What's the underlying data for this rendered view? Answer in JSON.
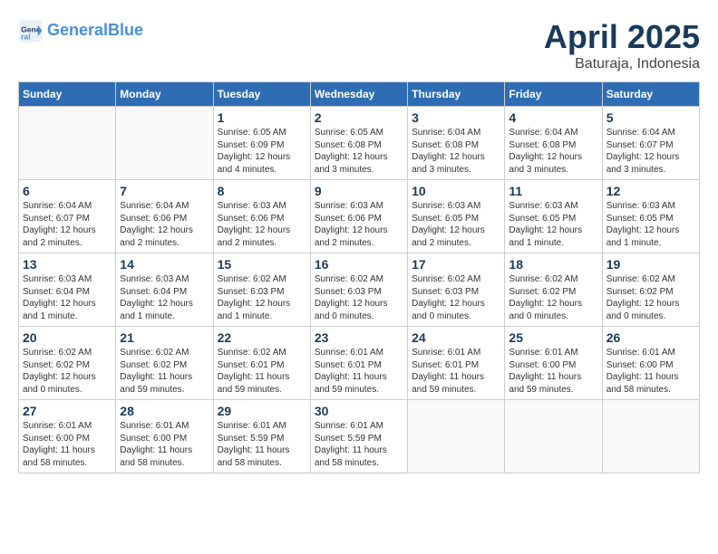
{
  "header": {
    "logo_line1": "General",
    "logo_line2": "Blue",
    "month": "April 2025",
    "location": "Baturaja, Indonesia"
  },
  "weekdays": [
    "Sunday",
    "Monday",
    "Tuesday",
    "Wednesday",
    "Thursday",
    "Friday",
    "Saturday"
  ],
  "weeks": [
    [
      {
        "day": "",
        "info": ""
      },
      {
        "day": "",
        "info": ""
      },
      {
        "day": "1",
        "info": "Sunrise: 6:05 AM\nSunset: 6:09 PM\nDaylight: 12 hours\nand 4 minutes."
      },
      {
        "day": "2",
        "info": "Sunrise: 6:05 AM\nSunset: 6:08 PM\nDaylight: 12 hours\nand 3 minutes."
      },
      {
        "day": "3",
        "info": "Sunrise: 6:04 AM\nSunset: 6:08 PM\nDaylight: 12 hours\nand 3 minutes."
      },
      {
        "day": "4",
        "info": "Sunrise: 6:04 AM\nSunset: 6:08 PM\nDaylight: 12 hours\nand 3 minutes."
      },
      {
        "day": "5",
        "info": "Sunrise: 6:04 AM\nSunset: 6:07 PM\nDaylight: 12 hours\nand 3 minutes."
      }
    ],
    [
      {
        "day": "6",
        "info": "Sunrise: 6:04 AM\nSunset: 6:07 PM\nDaylight: 12 hours\nand 2 minutes."
      },
      {
        "day": "7",
        "info": "Sunrise: 6:04 AM\nSunset: 6:06 PM\nDaylight: 12 hours\nand 2 minutes."
      },
      {
        "day": "8",
        "info": "Sunrise: 6:03 AM\nSunset: 6:06 PM\nDaylight: 12 hours\nand 2 minutes."
      },
      {
        "day": "9",
        "info": "Sunrise: 6:03 AM\nSunset: 6:06 PM\nDaylight: 12 hours\nand 2 minutes."
      },
      {
        "day": "10",
        "info": "Sunrise: 6:03 AM\nSunset: 6:05 PM\nDaylight: 12 hours\nand 2 minutes."
      },
      {
        "day": "11",
        "info": "Sunrise: 6:03 AM\nSunset: 6:05 PM\nDaylight: 12 hours\nand 1 minute."
      },
      {
        "day": "12",
        "info": "Sunrise: 6:03 AM\nSunset: 6:05 PM\nDaylight: 12 hours\nand 1 minute."
      }
    ],
    [
      {
        "day": "13",
        "info": "Sunrise: 6:03 AM\nSunset: 6:04 PM\nDaylight: 12 hours\nand 1 minute."
      },
      {
        "day": "14",
        "info": "Sunrise: 6:03 AM\nSunset: 6:04 PM\nDaylight: 12 hours\nand 1 minute."
      },
      {
        "day": "15",
        "info": "Sunrise: 6:02 AM\nSunset: 6:03 PM\nDaylight: 12 hours\nand 1 minute."
      },
      {
        "day": "16",
        "info": "Sunrise: 6:02 AM\nSunset: 6:03 PM\nDaylight: 12 hours\nand 0 minutes."
      },
      {
        "day": "17",
        "info": "Sunrise: 6:02 AM\nSunset: 6:03 PM\nDaylight: 12 hours\nand 0 minutes."
      },
      {
        "day": "18",
        "info": "Sunrise: 6:02 AM\nSunset: 6:02 PM\nDaylight: 12 hours\nand 0 minutes."
      },
      {
        "day": "19",
        "info": "Sunrise: 6:02 AM\nSunset: 6:02 PM\nDaylight: 12 hours\nand 0 minutes."
      }
    ],
    [
      {
        "day": "20",
        "info": "Sunrise: 6:02 AM\nSunset: 6:02 PM\nDaylight: 12 hours\nand 0 minutes."
      },
      {
        "day": "21",
        "info": "Sunrise: 6:02 AM\nSunset: 6:02 PM\nDaylight: 11 hours\nand 59 minutes."
      },
      {
        "day": "22",
        "info": "Sunrise: 6:02 AM\nSunset: 6:01 PM\nDaylight: 11 hours\nand 59 minutes."
      },
      {
        "day": "23",
        "info": "Sunrise: 6:01 AM\nSunset: 6:01 PM\nDaylight: 11 hours\nand 59 minutes."
      },
      {
        "day": "24",
        "info": "Sunrise: 6:01 AM\nSunset: 6:01 PM\nDaylight: 11 hours\nand 59 minutes."
      },
      {
        "day": "25",
        "info": "Sunrise: 6:01 AM\nSunset: 6:00 PM\nDaylight: 11 hours\nand 59 minutes."
      },
      {
        "day": "26",
        "info": "Sunrise: 6:01 AM\nSunset: 6:00 PM\nDaylight: 11 hours\nand 58 minutes."
      }
    ],
    [
      {
        "day": "27",
        "info": "Sunrise: 6:01 AM\nSunset: 6:00 PM\nDaylight: 11 hours\nand 58 minutes."
      },
      {
        "day": "28",
        "info": "Sunrise: 6:01 AM\nSunset: 6:00 PM\nDaylight: 11 hours\nand 58 minutes."
      },
      {
        "day": "29",
        "info": "Sunrise: 6:01 AM\nSunset: 5:59 PM\nDaylight: 11 hours\nand 58 minutes."
      },
      {
        "day": "30",
        "info": "Sunrise: 6:01 AM\nSunset: 5:59 PM\nDaylight: 11 hours\nand 58 minutes."
      },
      {
        "day": "",
        "info": ""
      },
      {
        "day": "",
        "info": ""
      },
      {
        "day": "",
        "info": ""
      }
    ]
  ]
}
